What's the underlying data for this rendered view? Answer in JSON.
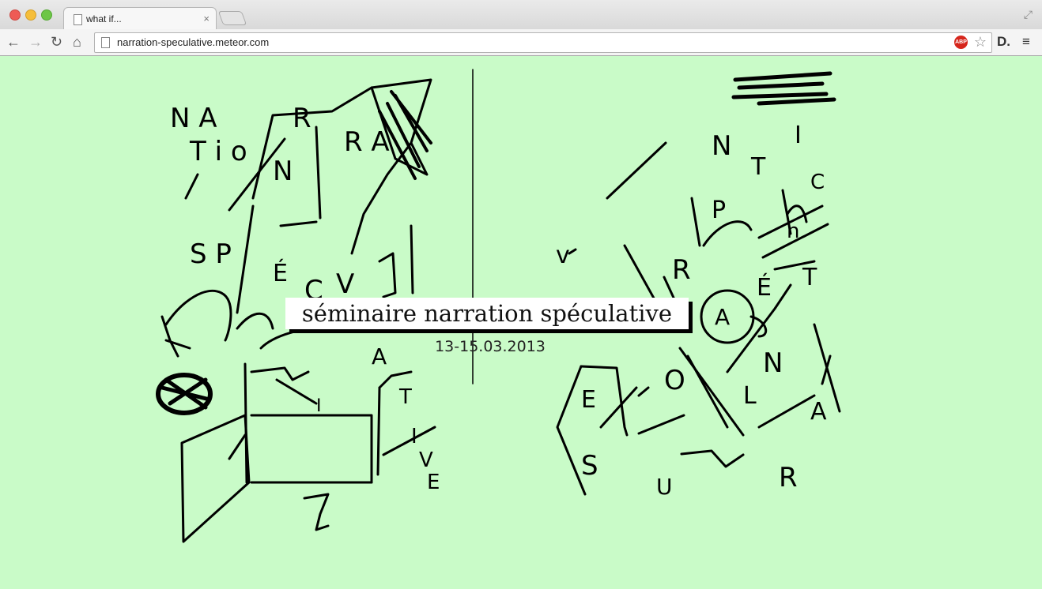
{
  "browser": {
    "tab_title": "what if...",
    "tab_close": "×",
    "url": "narration-speculative.meteor.com",
    "abp_label": "ABP",
    "extension_label": "D.",
    "icons": [
      "back-icon",
      "forward-icon",
      "reload-icon",
      "home-icon",
      "page-icon",
      "star-icon",
      "menu-icon",
      "fullscreen-icon"
    ]
  },
  "content": {
    "title": "séminaire narration spéculative",
    "date": "13-15.03.2013"
  }
}
